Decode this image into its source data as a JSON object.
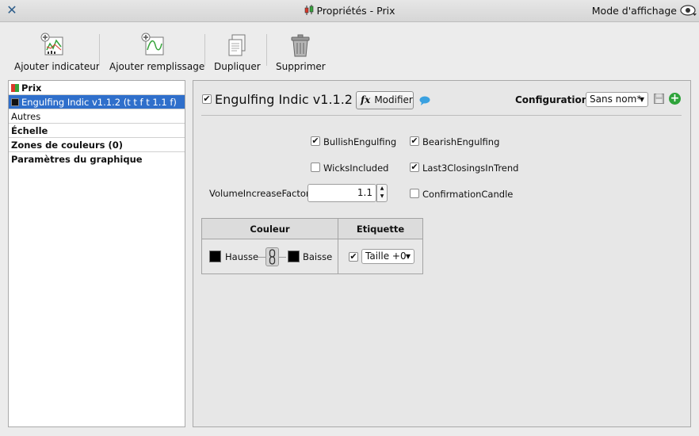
{
  "window": {
    "title": "Propriétés - Prix",
    "mode_label": "Mode d'affichage"
  },
  "toolbar": {
    "add_indicator": "Ajouter indicateur",
    "add_fill": "Ajouter remplissage",
    "duplicate": "Dupliquer",
    "delete": "Supprimer"
  },
  "tree": {
    "items": [
      {
        "label": "Prix",
        "bold": true,
        "swatch": "price"
      },
      {
        "label": "Engulfing Indic v1.1.2 (t t f t 1.1 f)",
        "bold": false,
        "swatch": "black",
        "selected": true
      },
      {
        "label": "Autres",
        "bold": false
      },
      {
        "label": "Échelle",
        "bold": true
      },
      {
        "label": "Zones de couleurs (0)",
        "bold": true
      },
      {
        "label": "Paramètres du graphique",
        "bold": true
      }
    ]
  },
  "indicator": {
    "enabled": true,
    "title": "Engulfing Indic v1.1.2",
    "modify_label": "Modifier",
    "fx_symbol": "fx",
    "config_label": "Configuration :",
    "config_value": "Sans nom*"
  },
  "params": {
    "bullish": {
      "label": "BullishEngulfing",
      "checked": true
    },
    "bearish": {
      "label": "BearishEngulfing",
      "checked": true
    },
    "wicks": {
      "label": "WicksIncluded",
      "checked": false
    },
    "last3": {
      "label": "Last3ClosingsInTrend",
      "checked": true
    },
    "confirmation": {
      "label": "ConfirmationCandle",
      "checked": false
    },
    "volume_label": "VolumeIncreaseFactor",
    "volume_value": "1.1"
  },
  "color_table": {
    "col_color": "Couleur",
    "col_label": "Etiquette",
    "up_label": "Hausse",
    "down_label": "Baisse",
    "up_color": "#000000",
    "down_color": "#000000",
    "label_checked": true,
    "size_value": "Taille +0"
  },
  "colors": {
    "selection": "#2f6fcb",
    "add_green": "#2ea33a"
  },
  "check_mark": "✔"
}
